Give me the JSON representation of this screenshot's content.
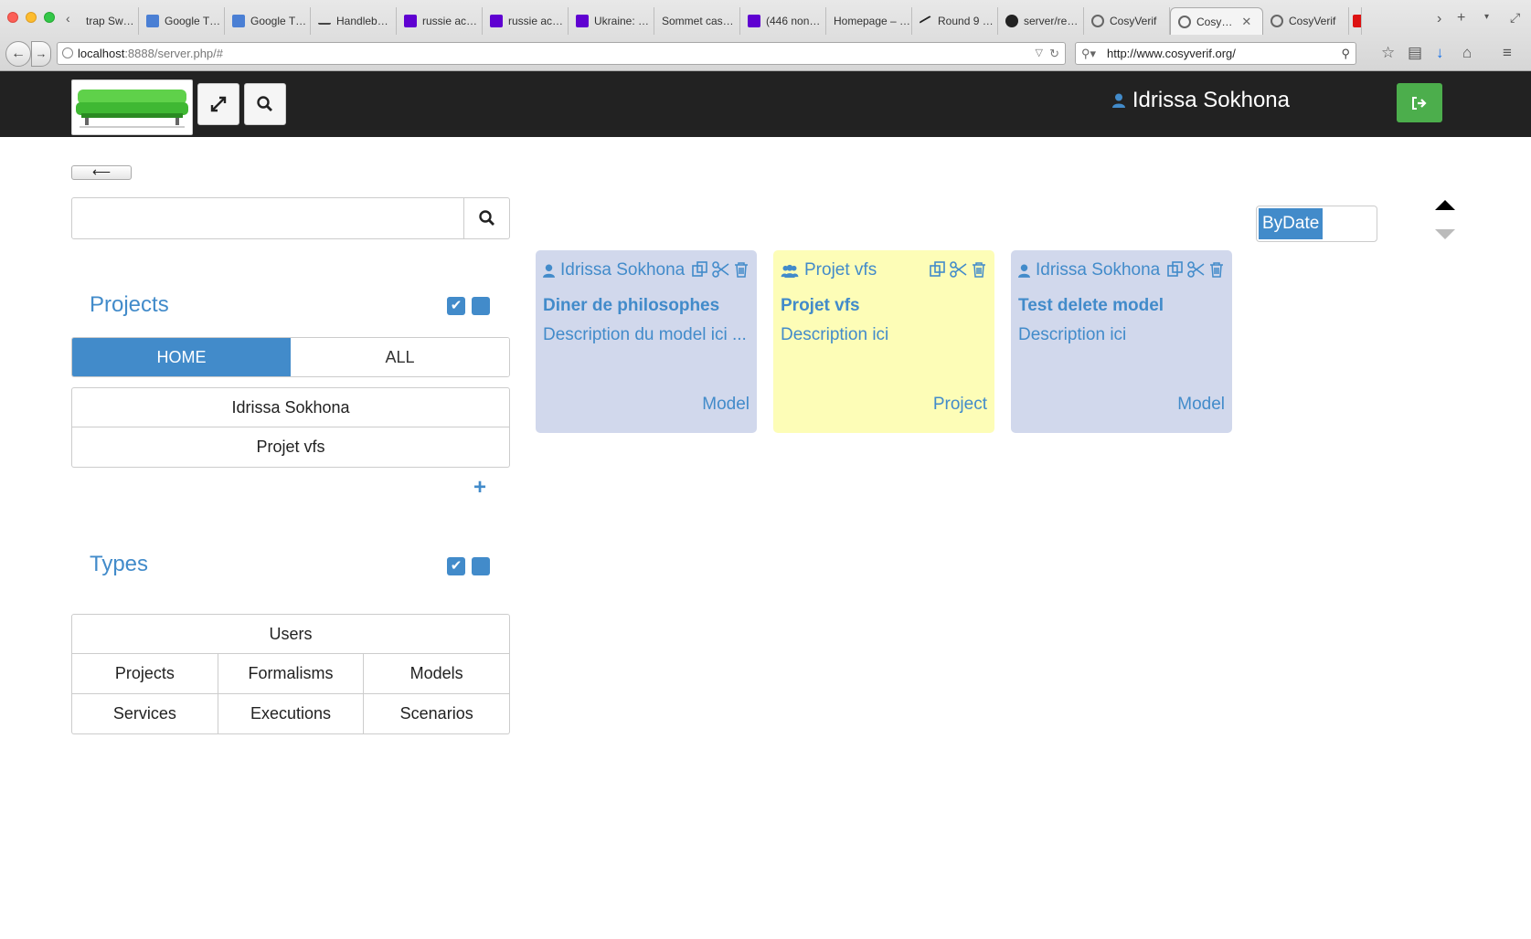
{
  "browser": {
    "tabs": [
      {
        "label": "trap Sw…",
        "icon": "page-icon"
      },
      {
        "label": "Google T…",
        "icon": "google-translate-icon"
      },
      {
        "label": "Google T…",
        "icon": "google-translate-icon"
      },
      {
        "label": "Handleb…",
        "icon": "handlebars-icon"
      },
      {
        "label": "russie ac…",
        "icon": "yahoo-icon"
      },
      {
        "label": "russie ac…",
        "icon": "yahoo-icon"
      },
      {
        "label": "Ukraine: …",
        "icon": "yahoo-icon"
      },
      {
        "label": "Sommet cas…",
        "icon": "page-icon"
      },
      {
        "label": "(446 non…",
        "icon": "yahoo-mail-icon"
      },
      {
        "label": "Homepage – …",
        "icon": "page-icon"
      },
      {
        "label": "Round 9 …",
        "icon": "page-icon"
      },
      {
        "label": "server/re…",
        "icon": "github-icon"
      },
      {
        "label": "CosyVerif",
        "icon": "cosyverif-icon"
      },
      {
        "label": "Cosy…",
        "icon": "cosyverif-icon",
        "active": true
      },
      {
        "label": "CosyVerif",
        "icon": "cosyverif-icon"
      }
    ],
    "url_host": "localhost",
    "url_rest": ":8888/server.php/#",
    "search_value": "http://www.cosyverif.org/"
  },
  "navbar": {
    "user_name": "Idrissa Sokhona"
  },
  "search": {
    "placeholder": ""
  },
  "projects_section": {
    "title": "Projects",
    "scope_tabs": [
      "HOME",
      "ALL"
    ],
    "active_scope": "HOME",
    "items": [
      "Idrissa Sokhona",
      "Projet vfs"
    ]
  },
  "types_section": {
    "title": "Types",
    "full_row": "Users",
    "grid": [
      [
        "Projects",
        "Formalisms",
        "Models"
      ],
      [
        "Services",
        "Executions",
        "Scenarios"
      ]
    ]
  },
  "sort": {
    "label": "ByDate"
  },
  "cards": [
    {
      "owner": "Idrissa Sokhona",
      "owner_icon": "user-icon",
      "title": "Diner de philosophes",
      "description": "Description du model ici ...",
      "type": "Model",
      "color": "#d1d8ec"
    },
    {
      "owner": "Projet vfs",
      "owner_icon": "users-icon",
      "title": "Projet vfs",
      "description": "Description ici",
      "type": "Project",
      "color": "#fdfdb7"
    },
    {
      "owner": "Idrissa Sokhona",
      "owner_icon": "user-icon",
      "title": "Test delete model",
      "description": "Description ici",
      "type": "Model",
      "color": "#d1d8ec"
    }
  ],
  "colors": {
    "accent": "#428bca",
    "navbar_bg": "#222222",
    "logout_green": "#4cae4c"
  }
}
